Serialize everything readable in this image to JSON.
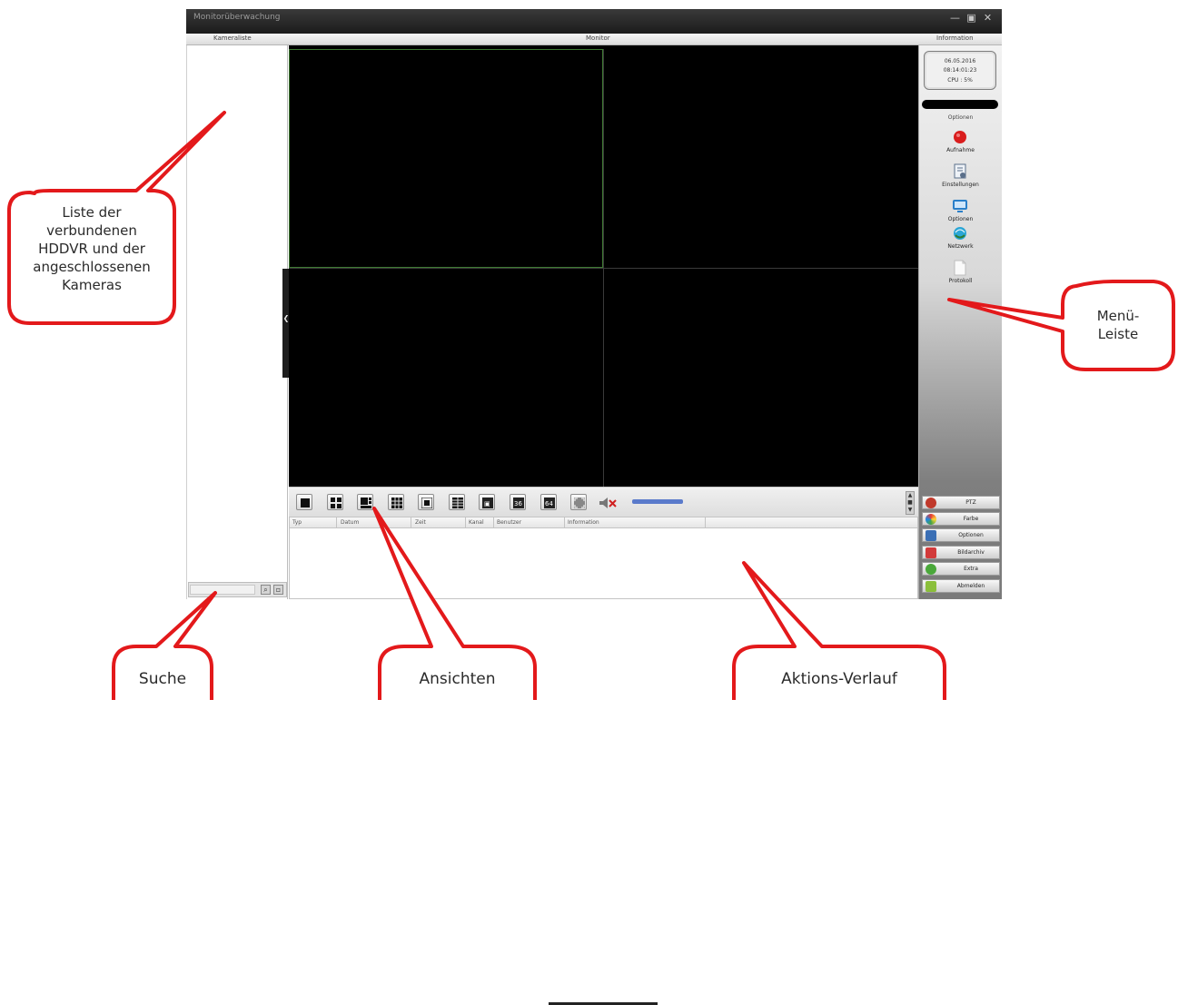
{
  "window": {
    "title": "Monitorüberwachung",
    "minimize_glyph": "—",
    "maximize_glyph": "▣",
    "close_glyph": "✕"
  },
  "menubar": {
    "left": "Kameraliste",
    "center": "Monitor",
    "right": "Information"
  },
  "info": {
    "date": "06.05.2016",
    "time": "08:14:01:23",
    "cpu": "CPU : 5%"
  },
  "options_header": "Optionen",
  "side_menu": [
    {
      "label": "Aufnahme",
      "icon": "record-icon",
      "color": "#d91d1d"
    },
    {
      "label": "Einstellungen",
      "icon": "settings-document-icon",
      "color": "#5a6f8a"
    },
    {
      "label": "Optionen",
      "icon": "monitor-options-icon",
      "color": "#2a7fc9"
    },
    {
      "label": "Netzwerk",
      "icon": "network-icon",
      "color": "#2aa6d6"
    },
    {
      "label": "Protokoll",
      "icon": "log-document-icon",
      "color": "#bdbdbd"
    }
  ],
  "bottom_buttons": [
    {
      "label": "PTZ",
      "icon": "ptz-icon",
      "color": "#c0392b"
    },
    {
      "label": "Farbe",
      "icon": "color-icon",
      "color": "#2b8bd3"
    },
    {
      "label": "Optionen",
      "icon": "options-icon",
      "color": "#3b6fb5"
    },
    {
      "label": "Bildarchiv",
      "icon": "archive-icon",
      "color": "#d23a3a"
    },
    {
      "label": "Extra",
      "icon": "extra-icon",
      "color": "#4aa83a"
    },
    {
      "label": "Abmelden",
      "icon": "logout-icon",
      "color": "#8bbf3b"
    }
  ],
  "log_columns": [
    "Typ",
    "Datum",
    "Zeit",
    "Kanal",
    "Benutzer",
    "Information"
  ],
  "search": {
    "value": ""
  },
  "collapse_glyph": "❮",
  "view_buttons": [
    "1",
    "4",
    "6",
    "8",
    "9",
    "10",
    "16",
    "25",
    "36",
    "64",
    "fullscreen",
    "mute"
  ],
  "callouts": {
    "camera_list": "Liste der\nverbundenen\nHDDVR und der\nangeschlossenen\nKameras",
    "menu_bar": "Menü-\nLeiste",
    "search": "Suche",
    "views": "Ansichten",
    "history": "Aktions-Verlauf"
  },
  "colors": {
    "callout_red": "#e3191b",
    "active_cell_border": "#3e7a32"
  }
}
